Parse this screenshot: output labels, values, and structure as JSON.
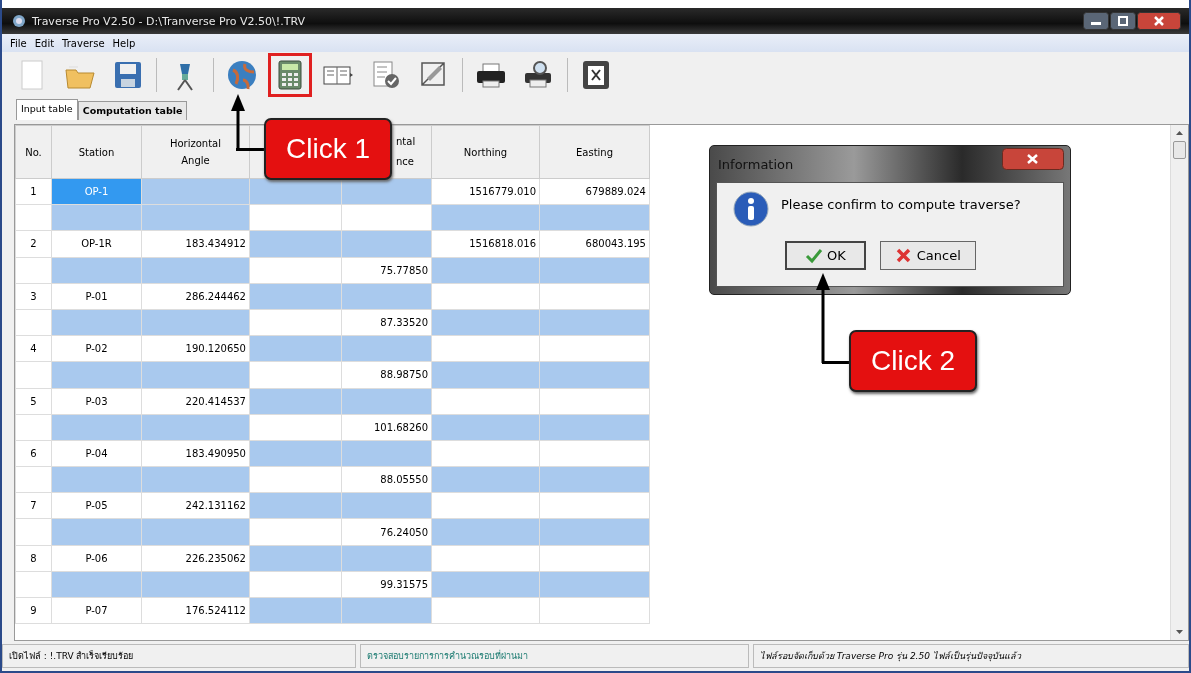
{
  "window": {
    "title": "Traverse Pro V2.50 - D:\\Tranverse Pro V2.50\\!.TRV"
  },
  "menu": [
    "File",
    "Edit",
    "Traverse",
    "Help"
  ],
  "toolbar": [
    {
      "kind": "new"
    },
    {
      "kind": "open"
    },
    {
      "kind": "save"
    },
    {
      "kind": "sep"
    },
    {
      "kind": "instrument"
    },
    {
      "kind": "sep"
    },
    {
      "kind": "globe"
    },
    {
      "kind": "calculator",
      "highlighted": true
    },
    {
      "kind": "book"
    },
    {
      "kind": "check"
    },
    {
      "kind": "drafting"
    },
    {
      "kind": "sep"
    },
    {
      "kind": "printer"
    },
    {
      "kind": "preview"
    },
    {
      "kind": "sep"
    },
    {
      "kind": "excel"
    }
  ],
  "tabs": [
    {
      "label": "Input table",
      "selected": true
    },
    {
      "label": "Computation table",
      "selected": false
    }
  ],
  "table": {
    "columns": [
      {
        "label": "No."
      },
      {
        "label": "Station"
      },
      {
        "label": "Horizontal Angle"
      },
      {},
      {
        "label": "ntal nce"
      },
      {
        "label": "Northing"
      },
      {
        "label": "Easting"
      }
    ],
    "rows": [
      {
        "kind": "station",
        "no": "1",
        "station": "OP-1",
        "northing": "1516779.010",
        "easting": "679889.024",
        "selected": true
      },
      {
        "kind": "leg"
      },
      {
        "kind": "station",
        "no": "2",
        "station": "OP-1R",
        "angle": "183.434912",
        "northing": "1516818.016",
        "easting": "680043.195",
        "selected": false
      },
      {
        "kind": "leg",
        "distance": "75.77850"
      },
      {
        "kind": "station",
        "no": "3",
        "station": "P-01",
        "angle": "286.244462",
        "selected": false
      },
      {
        "kind": "leg",
        "distance": "87.33520"
      },
      {
        "kind": "station",
        "no": "4",
        "station": "P-02",
        "angle": "190.120650",
        "selected": false
      },
      {
        "kind": "leg",
        "distance": "88.98750"
      },
      {
        "kind": "station",
        "no": "5",
        "station": "P-03",
        "angle": "220.414537",
        "selected": false
      },
      {
        "kind": "leg",
        "distance": "101.68260"
      },
      {
        "kind": "station",
        "no": "6",
        "station": "P-04",
        "angle": "183.490950",
        "selected": false
      },
      {
        "kind": "leg",
        "distance": "88.05550"
      },
      {
        "kind": "station",
        "no": "7",
        "station": "P-05",
        "angle": "242.131162",
        "selected": false
      },
      {
        "kind": "leg",
        "distance": "76.24050"
      },
      {
        "kind": "station",
        "no": "8",
        "station": "P-06",
        "angle": "226.235062",
        "selected": false
      },
      {
        "kind": "leg",
        "distance": "99.31575"
      },
      {
        "kind": "station",
        "no": "9",
        "station": "P-07",
        "angle": "176.524112",
        "selected": false
      }
    ]
  },
  "dialog": {
    "title": "Information",
    "message": "Please confirm to compute traverse?",
    "buttons": [
      {
        "kind": "ok",
        "label": "OK"
      },
      {
        "kind": "cancel",
        "label": "Cancel"
      }
    ]
  },
  "annotations": [
    {
      "kind": "toolbar",
      "label": "Click 1"
    },
    {
      "kind": "dialog",
      "label": "Click 2"
    }
  ],
  "status_bar": [
    "เปิดไฟล์ : !.TRV สำเร็จเรียบร้อย",
    "ตรวจสอบรายการการคำนวณรอบที่ผ่านมา",
    "ไฟล์รอบจัดเก็บด้วย Traverse Pro รุ่น 2.50 ไฟล์เป็นรุ่นปัจจุบันแล้ว"
  ]
}
